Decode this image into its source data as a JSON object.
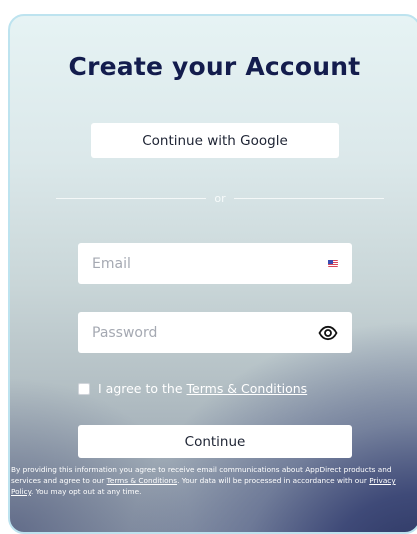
{
  "title": "Create your Account",
  "google_button": {
    "label": "Continue with Google"
  },
  "divider": {
    "text": "or"
  },
  "email_field": {
    "placeholder": "Email",
    "icon": "us-flag-icon"
  },
  "password_field": {
    "placeholder": "Password",
    "icon": "eye-icon"
  },
  "agree": {
    "text": "I agree to the",
    "link": "Terms & Conditions",
    "checked": false
  },
  "continue_button": {
    "label": "Continue"
  },
  "legal": {
    "part1": "By providing this information you agree to receive email communications about AppDirect products and services and agree to our ",
    "terms_link": "Terms & Conditions",
    "part2": ". Your data will be processed in accordance with our ",
    "privacy_link": "Privacy Policy",
    "part3": ". You may opt out at any time."
  },
  "colors": {
    "title": "#131c4d",
    "card_border": "#bde3ef",
    "gradient_dark": "#28325e"
  }
}
